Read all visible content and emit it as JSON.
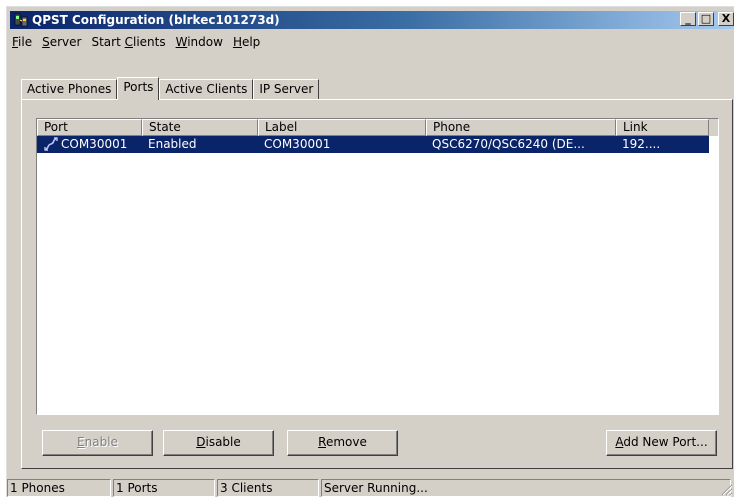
{
  "window": {
    "title": "QPST Configuration (blrkec101273d)",
    "app_icon": "qpst-app-icon",
    "buttons": {
      "minimize": "_",
      "maximize": "□",
      "close": "X"
    }
  },
  "menu": {
    "file": {
      "accel": "F",
      "rest": "ile"
    },
    "server": {
      "accel": "S",
      "rest": "erver"
    },
    "start_clients": {
      "pre": "Start ",
      "accel": "C",
      "rest": "lients"
    },
    "window": {
      "accel": "W",
      "rest": "indow"
    },
    "help": {
      "accel": "H",
      "rest": "elp"
    }
  },
  "tabs": [
    {
      "label": "Active Phones",
      "active": false
    },
    {
      "label": "Ports",
      "active": true
    },
    {
      "label": "Active Clients",
      "active": false
    },
    {
      "label": "IP Server",
      "active": false
    }
  ],
  "ports_table": {
    "columns": [
      "Port",
      "State",
      "Label",
      "Phone",
      "Link"
    ],
    "rows": [
      {
        "icon": "serial-port-icon",
        "port": "COM30001",
        "state": "Enabled",
        "label": "COM30001",
        "phone": "QSC6270/QSC6240 (DE...",
        "link": "192....",
        "selected": true
      }
    ]
  },
  "buttons": {
    "enable": {
      "accel": "E",
      "rest": "nable",
      "enabled": false
    },
    "disable": {
      "accel": "D",
      "rest": "isable",
      "enabled": true
    },
    "remove": {
      "accel": "R",
      "rest": "emove",
      "enabled": true
    },
    "add_new_port": {
      "accel": "A",
      "rest": "dd New Port...",
      "enabled": true
    }
  },
  "status_bar": {
    "phones": "1 Phones",
    "ports": "1 Ports",
    "clients": "3 Clients",
    "server": "Server Running..."
  },
  "colors": {
    "face": "#d4d0c8",
    "selection": "#0a246a",
    "title_start": "#0a246a",
    "title_end": "#a6caf0"
  }
}
